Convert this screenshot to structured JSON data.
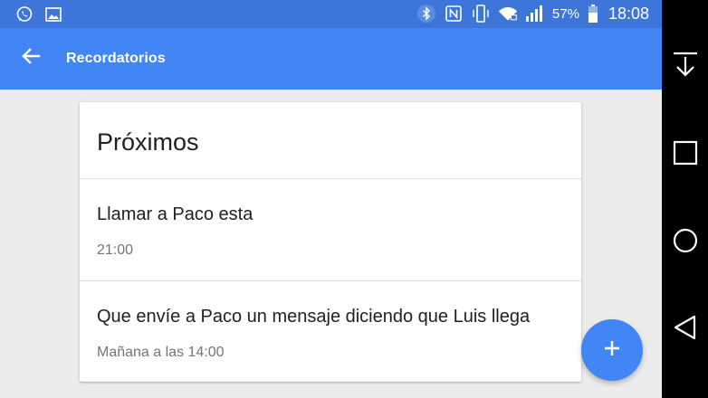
{
  "status_bar": {
    "left_icons": [
      "whatsapp-icon",
      "image-icon"
    ],
    "right_icons": [
      "bluetooth-icon",
      "nfc-icon",
      "vibrate-icon",
      "wifi-icon",
      "signal-icon"
    ],
    "battery_percent": "57%",
    "time": "18:08"
  },
  "app_bar": {
    "title": "Recordatorios",
    "back_icon": "arrow-back-icon"
  },
  "card": {
    "title": "Próximos",
    "items": [
      {
        "title": "Llamar a Paco esta",
        "time": "21:00"
      },
      {
        "title": "Que envíe a Paco un mensaje diciendo que Luis llega",
        "time": "Mañana a las 14:00"
      }
    ]
  },
  "fab": {
    "icon": "plus-icon"
  },
  "nav_bar": {
    "icons": [
      "notification-pull-icon",
      "recents-icon",
      "home-icon",
      "back-icon"
    ]
  },
  "colors": {
    "status_bar": "#3d76d8",
    "app_bar": "#4285f4",
    "background": "#ececec",
    "fab": "#4285f4",
    "nav_bar": "#000000"
  }
}
